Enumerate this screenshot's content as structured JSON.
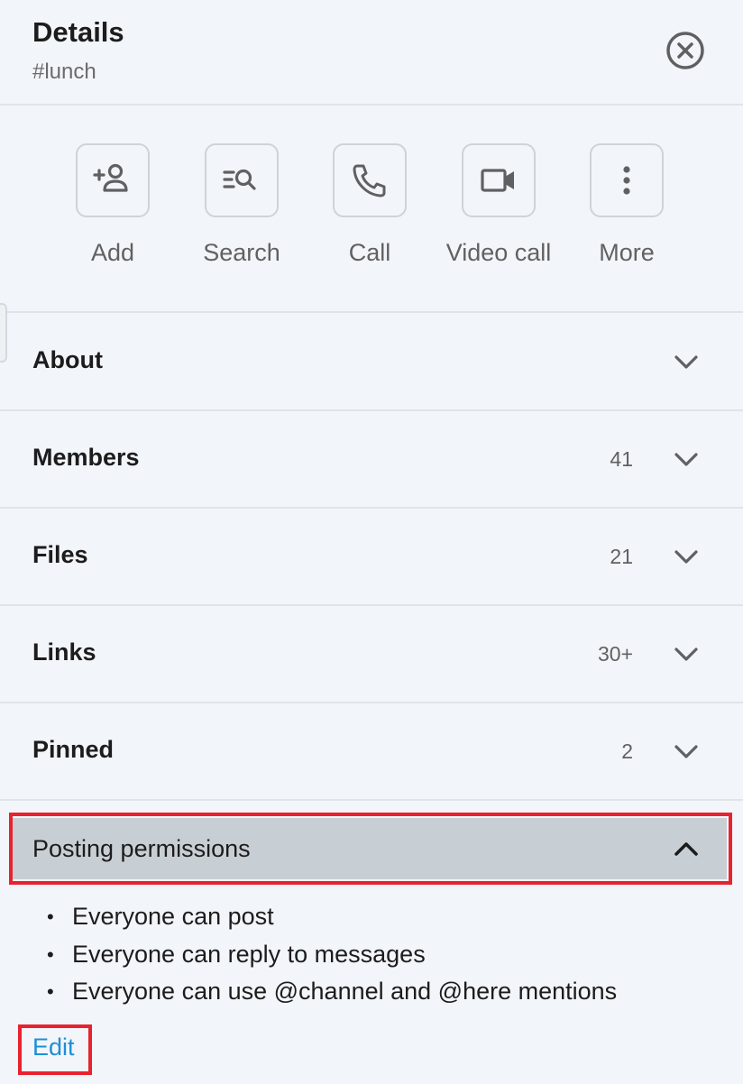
{
  "header": {
    "title": "Details",
    "channel": "#lunch",
    "close_icon": "close-circle-icon"
  },
  "actions": [
    {
      "label": "Add",
      "icon": "add-person-icon"
    },
    {
      "label": "Search",
      "icon": "search-list-icon"
    },
    {
      "label": "Call",
      "icon": "phone-icon"
    },
    {
      "label": "Video call",
      "icon": "video-camera-icon"
    },
    {
      "label": "More",
      "icon": "more-vertical-icon"
    }
  ],
  "sections": [
    {
      "label": "About",
      "count": ""
    },
    {
      "label": "Members",
      "count": "41"
    },
    {
      "label": "Files",
      "count": "21"
    },
    {
      "label": "Links",
      "count": "30+"
    },
    {
      "label": "Pinned",
      "count": "2"
    }
  ],
  "posting": {
    "label": "Posting permissions",
    "expanded": true,
    "items": [
      "Everyone can post",
      "Everyone can reply to messages",
      "Everyone can use @channel and @here mentions"
    ],
    "bullet": "•",
    "edit_label": "Edit"
  },
  "colors": {
    "background": "#f2f5f9",
    "highlight": "#e8222e",
    "link": "#1d8fd6",
    "selected_row": "#c8cfd4"
  }
}
